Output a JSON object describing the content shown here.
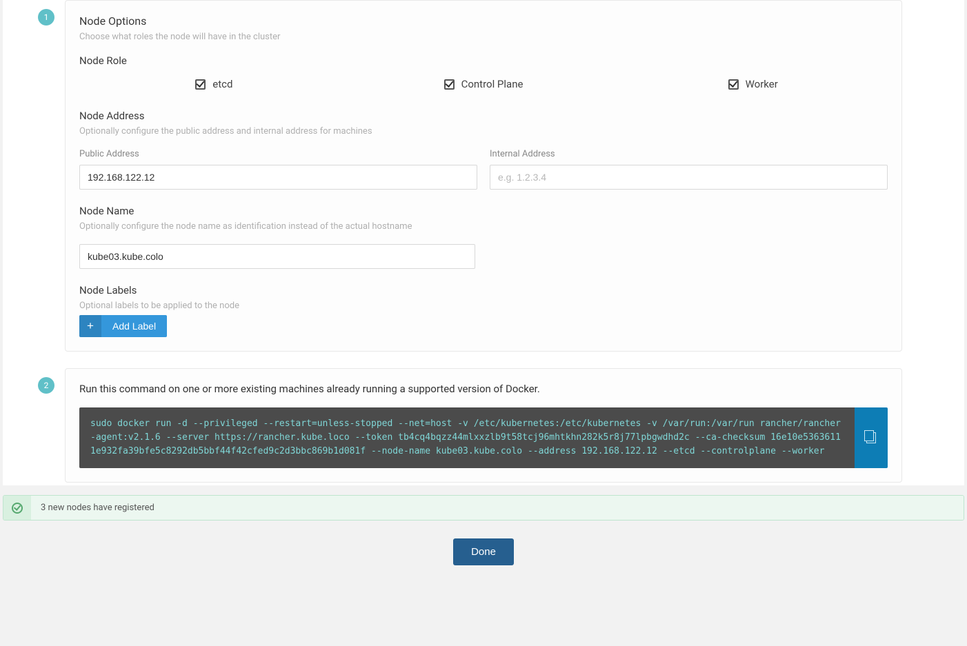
{
  "step1": {
    "badge": "1",
    "title": "Node Options",
    "subtitle": "Choose what roles the node will have in the cluster",
    "node_role_label": "Node Role",
    "roles": {
      "etcd": "etcd",
      "control_plane": "Control Plane",
      "worker": "Worker"
    },
    "address": {
      "title": "Node Address",
      "subtitle": "Optionally configure the public address and internal address for machines",
      "public_label": "Public Address",
      "public_value": "192.168.122.12",
      "internal_label": "Internal Address",
      "internal_placeholder": "e.g. 1.2.3.4"
    },
    "name": {
      "title": "Node Name",
      "subtitle": "Optionally configure the node name as identification instead of the actual hostname",
      "value": "kube03.kube.colo"
    },
    "labels": {
      "title": "Node Labels",
      "subtitle": "Optional labels to be applied to the node",
      "add_button": "Add Label"
    }
  },
  "step2": {
    "badge": "2",
    "title": "Run this command on one or more existing machines already running a supported version of Docker.",
    "command": "sudo docker run -d --privileged --restart=unless-stopped --net=host -v /etc/kubernetes:/etc/kubernetes -v /var/run:/var/run rancher/rancher-agent:v2.1.6 --server https://rancher.kube.loco --token tb4cq4bqzz44mlxxzlb9t58tcj96mhtkhn282k5r8j77lpbgwdhd2c --ca-checksum 16e10e53636111e932fa39bfe5c8292db5bbf44f42cfed9c2d3bbc869b1d081f --node-name kube03.kube.colo --address 192.168.122.12 --etcd --controlplane --worker"
  },
  "notification": "3 new nodes have registered",
  "done_button": "Done"
}
